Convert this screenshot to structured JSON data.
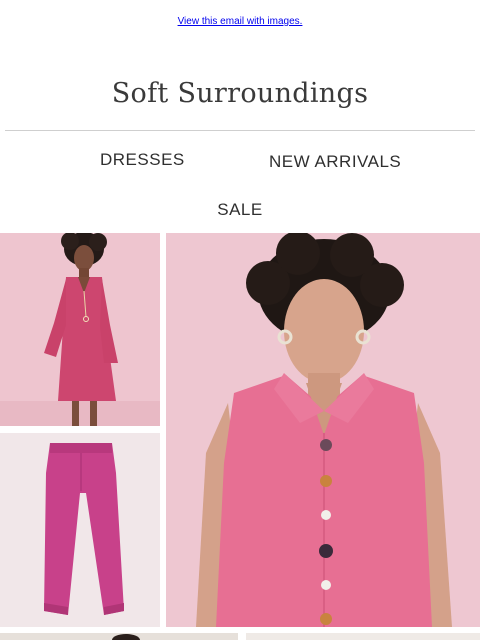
{
  "header": {
    "view_link": "View this email with images."
  },
  "brand": {
    "logo_text": "Soft Surroundings"
  },
  "nav": {
    "dresses": "DRESSES",
    "new_arrivals": "NEW ARRIVALS",
    "sale": "SALE"
  },
  "colors": {
    "link": "#0000ee",
    "product_pink": "#e76f93",
    "photo_background": "#eec7d1"
  }
}
